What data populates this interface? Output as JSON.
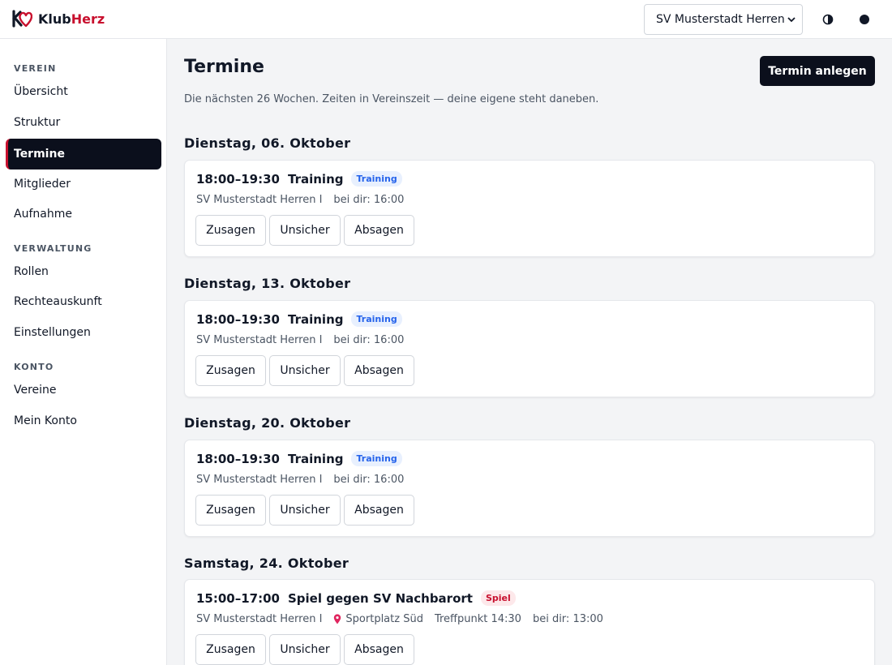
{
  "header": {
    "logo_text_a": "Klub",
    "logo_text_b": "Herz",
    "team_select_value": "SV Musterstadt Herren I",
    "theme_icon": "contrast-icon",
    "avatar_icon": "user-dot-icon",
    "brand_color": "#c8102e"
  },
  "sidebar": {
    "sections": [
      {
        "label": "VEREIN",
        "items": [
          "Übersicht",
          "Struktur",
          "Termine",
          "Mitglieder",
          "Aufnahme"
        ]
      },
      {
        "label": "VERWALTUNG",
        "items": [
          "Rollen",
          "Rechteauskunft",
          "Einstellungen"
        ]
      },
      {
        "label": "KONTO",
        "items": [
          "Vereine",
          "Mein Konto"
        ]
      }
    ],
    "active_item": "Termine"
  },
  "main": {
    "title": "Termine",
    "subtitle": "Die nächsten 26 Wochen. Zeiten in Vereinszeit — deine eigene steht daneben.",
    "create_button": "Termin anlegen",
    "rsvp_labels": {
      "yes": "Zusagen",
      "maybe": "Unsicher",
      "no": "Absagen"
    },
    "days": [
      {
        "heading": "Dienstag, 06. Oktober",
        "event": {
          "time": "18:00–19:30",
          "title": "Training",
          "badge": "Training",
          "team": "SV Musterstadt Herren I",
          "location": "",
          "meeting": "",
          "local_time": "bei dir: 16:00"
        }
      },
      {
        "heading": "Dienstag, 13. Oktober",
        "event": {
          "time": "18:00–19:30",
          "title": "Training",
          "badge": "Training",
          "team": "SV Musterstadt Herren I",
          "location": "",
          "meeting": "",
          "local_time": "bei dir: 16:00"
        }
      },
      {
        "heading": "Dienstag, 20. Oktober",
        "event": {
          "time": "18:00–19:30",
          "title": "Training",
          "badge": "Training",
          "team": "SV Musterstadt Herren I",
          "location": "",
          "meeting": "",
          "local_time": "bei dir: 16:00"
        }
      },
      {
        "heading": "Samstag, 24. Oktober",
        "event": {
          "time": "15:00–17:00",
          "title": "Spiel gegen SV Nachbarort",
          "badge": "Spiel",
          "team": "SV Musterstadt Herren I",
          "location": "Sportplatz Süd",
          "meeting": "Treffpunkt 14:30",
          "local_time": "bei dir: 13:00"
        }
      }
    ]
  }
}
